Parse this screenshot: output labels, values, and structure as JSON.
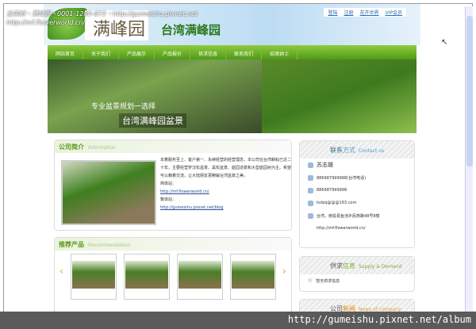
{
  "watermark": {
    "line1": "古美树・满峰园・0001-1280-873・http://gumeishu.pixnet.net",
    "line2": "http://mf.flowerworld.cn/"
  },
  "header": {
    "logo": "满峰园",
    "title": "台湾满峰园",
    "links": [
      "登陆",
      "注册",
      "花卉世界",
      "VIP会员"
    ]
  },
  "nav": [
    "网站首页",
    "关于我们",
    "产品展示",
    "产品报价",
    "供求信息",
    "联系我们",
    "招贤纳士"
  ],
  "banner": {
    "line1": "专业盆景规划一选择",
    "line2": "台湾满峰园盆景"
  },
  "intro": {
    "title": "公司简介",
    "subtitle": "Information",
    "text": "本着服务至上、客户第一、永续经营的经营理念，本公司在台湾耕耘已近二十年，主要经营罗汉松盆景、黑松盆景、庭园造景和大型庭园树为主。希望可以藉着交流，让大陆朋友更瞭解台湾盆景之美。",
    "label1": "简体站：",
    "link1": "http://mf.flowerworld.cn/",
    "label2": "繁体站：",
    "link2": "http://gumeishu.pixnet.net/blog"
  },
  "products": {
    "title": "推荐产品",
    "subtitle": "Recommendation"
  },
  "contact": {
    "title_a": "联系",
    "title_b": "方式",
    "subtitle": "Contact us",
    "name": "苏志雄",
    "phone": "886987999998(台湾电话)",
    "mobile": "886987999998",
    "email": "tsdzq@@@163.com",
    "address": "台湾，南投县鱼池乡民族路48号8楼",
    "url": "http://mf.flowerworld.cn/"
  },
  "supply": {
    "title_a": "供求",
    "title_b": "信息",
    "subtitle": "Supply & Demand",
    "item": "暂无供求信息"
  },
  "news": {
    "title_a": "公司",
    "title_b": "新闻",
    "subtitle": "News of company"
  },
  "overlay_url": "http://gumeishu.pixnet.net/album"
}
